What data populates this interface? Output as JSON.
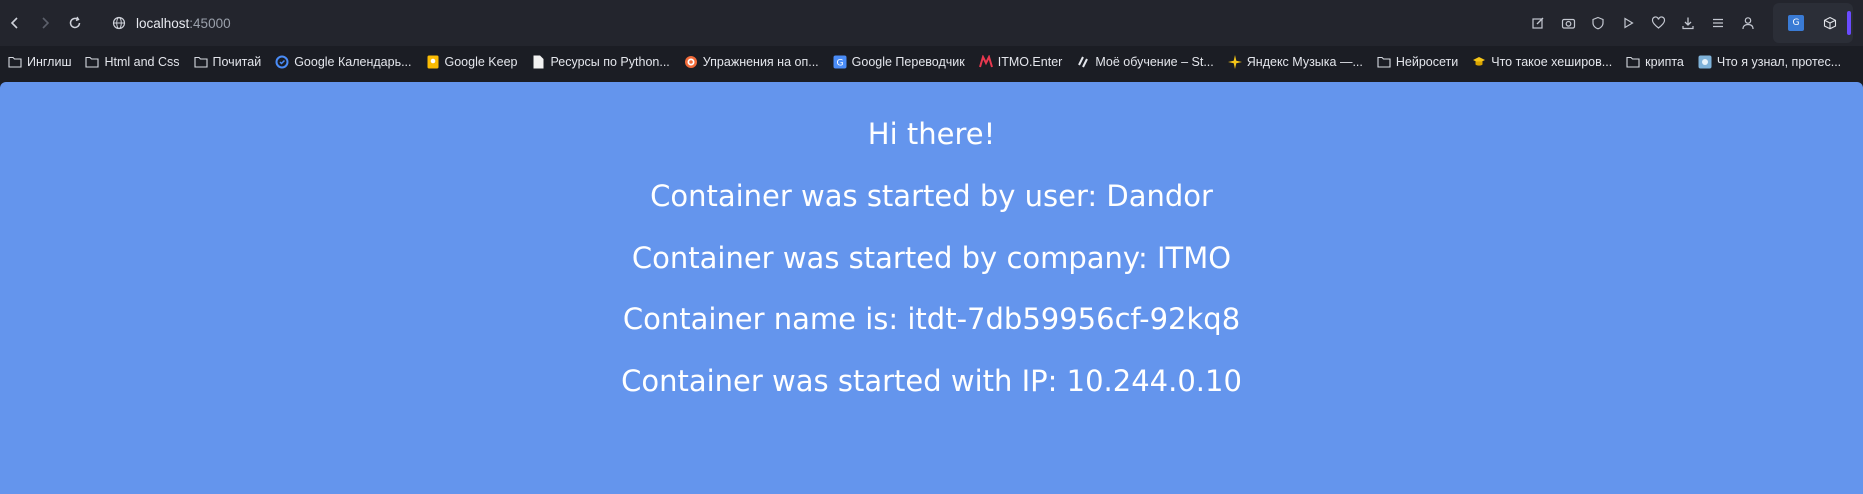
{
  "browser": {
    "url_host": "localhost",
    "url_port": ":45000"
  },
  "toolbar_icons": [
    "edit-icon",
    "camera-icon",
    "shield-icon",
    "play-icon",
    "heart-icon",
    "download-icon",
    "menu-icon",
    "profile-icon"
  ],
  "bookmarks": [
    {
      "label": "Инглиш",
      "icon": "folder-icon"
    },
    {
      "label": "Html and Css",
      "icon": "folder-icon"
    },
    {
      "label": "Почитай",
      "icon": "folder-icon"
    },
    {
      "label": "Google Календарь...",
      "icon": "google-calendar-icon"
    },
    {
      "label": "Google Keep",
      "icon": "google-keep-icon"
    },
    {
      "label": "Ресурсы по Python...",
      "icon": "document-icon"
    },
    {
      "label": "Упражнения на оп...",
      "icon": "target-icon"
    },
    {
      "label": "Google Переводчик",
      "icon": "google-translate-icon"
    },
    {
      "label": "ITMO.Enter",
      "icon": "itmo-icon"
    },
    {
      "label": "Моё обучение – St...",
      "icon": "stepik-icon"
    },
    {
      "label": "Яндекс Музыка —...",
      "icon": "yandex-music-icon"
    },
    {
      "label": "Нейросети",
      "icon": "folder-icon"
    },
    {
      "label": "Что такое хеширов...",
      "icon": "graduation-icon"
    },
    {
      "label": "крипта",
      "icon": "folder-icon"
    },
    {
      "label": "Что я узнал, протес...",
      "icon": "site-icon"
    }
  ],
  "page": {
    "background": "#6495ed",
    "greeting": "Hi there!",
    "user_line": "Container was started by user: Dandor",
    "company_line": "Container was started by company: ITMO",
    "name_line": "Container name is: itdt-7db59956cf-92kq8",
    "ip_line": "Container was started with IP: 10.244.0.10"
  }
}
